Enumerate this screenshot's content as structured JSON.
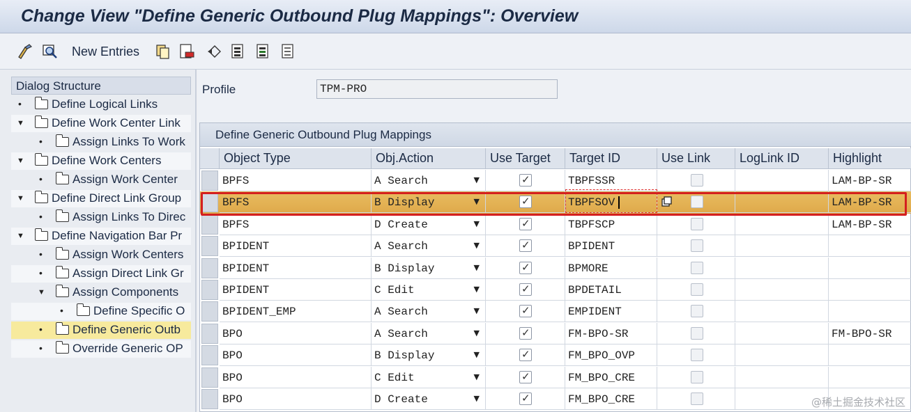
{
  "window": {
    "title": "Change View \"Define Generic Outbound Plug Mappings\": Overview"
  },
  "toolbar": {
    "new_entries_label": "New Entries"
  },
  "dialog_structure": {
    "header": "Dialog Structure",
    "items": [
      {
        "label": "Define Logical Links",
        "level": 0,
        "expander": "bullet"
      },
      {
        "label": "Define Work Center Link",
        "level": 0,
        "expander": "open"
      },
      {
        "label": "Assign Links To Work",
        "level": 1,
        "expander": "bullet"
      },
      {
        "label": "Define Work Centers",
        "level": 0,
        "expander": "open"
      },
      {
        "label": "Assign Work Center",
        "level": 1,
        "expander": "bullet"
      },
      {
        "label": "Define Direct Link Group",
        "level": 0,
        "expander": "open"
      },
      {
        "label": "Assign Links To Direc",
        "level": 1,
        "expander": "bullet"
      },
      {
        "label": "Define Navigation Bar Pr",
        "level": 0,
        "expander": "open"
      },
      {
        "label": "Assign Work Centers",
        "level": 1,
        "expander": "bullet"
      },
      {
        "label": "Assign Direct Link Gr",
        "level": 1,
        "expander": "bullet"
      },
      {
        "label": "Assign Components",
        "level": 1,
        "expander": "open"
      },
      {
        "label": "Define Specific O",
        "level": 2,
        "expander": "bullet"
      },
      {
        "label": "Define Generic Outb",
        "level": 1,
        "expander": "bullet",
        "selected": true
      },
      {
        "label": "Override Generic OP",
        "level": 1,
        "expander": "bullet"
      }
    ]
  },
  "profile": {
    "label": "Profile",
    "value": "TPM-PRO"
  },
  "table": {
    "title": "Define Generic Outbound Plug Mappings",
    "columns": [
      "Object Type",
      "Obj.Action",
      "Use Target",
      "Target ID",
      "Use Link",
      "LogLink ID",
      "Highlight"
    ],
    "rows": [
      {
        "object_type": "BPFS",
        "obj_action": "A Search",
        "use_target": true,
        "target_id": "TBPFSSR",
        "use_link": false,
        "loglink_id": "",
        "highlight": "LAM-BP-SR"
      },
      {
        "object_type": "BPFS",
        "obj_action": "B Display",
        "use_target": true,
        "target_id": "TBPFSOV",
        "use_link": false,
        "loglink_id": "",
        "highlight": "LAM-BP-SR",
        "selected": true
      },
      {
        "object_type": "BPFS",
        "obj_action": "D Create",
        "use_target": true,
        "target_id": "TBPFSCP",
        "use_link": false,
        "loglink_id": "",
        "highlight": "LAM-BP-SR"
      },
      {
        "object_type": "BPIDENT",
        "obj_action": "A Search",
        "use_target": true,
        "target_id": "BPIDENT",
        "use_link": false,
        "loglink_id": "",
        "highlight": ""
      },
      {
        "object_type": "BPIDENT",
        "obj_action": "B Display",
        "use_target": true,
        "target_id": "BPMORE",
        "use_link": false,
        "loglink_id": "",
        "highlight": ""
      },
      {
        "object_type": "BPIDENT",
        "obj_action": "C Edit",
        "use_target": true,
        "target_id": "BPDETAIL",
        "use_link": false,
        "loglink_id": "",
        "highlight": ""
      },
      {
        "object_type": "BPIDENT_EMP",
        "obj_action": "A Search",
        "use_target": true,
        "target_id": "EMPIDENT",
        "use_link": false,
        "loglink_id": "",
        "highlight": ""
      },
      {
        "object_type": "BPO",
        "obj_action": "A Search",
        "use_target": true,
        "target_id": "FM-BPO-SR",
        "use_link": false,
        "loglink_id": "",
        "highlight": "FM-BPO-SR"
      },
      {
        "object_type": "BPO",
        "obj_action": "B Display",
        "use_target": true,
        "target_id": "FM_BPO_OVP",
        "use_link": false,
        "loglink_id": "",
        "highlight": ""
      },
      {
        "object_type": "BPO",
        "obj_action": "C Edit",
        "use_target": true,
        "target_id": "FM_BPO_CRE",
        "use_link": false,
        "loglink_id": "",
        "highlight": ""
      },
      {
        "object_type": "BPO",
        "obj_action": "D Create",
        "use_target": true,
        "target_id": "FM_BPO_CRE",
        "use_link": false,
        "loglink_id": "",
        "highlight": ""
      }
    ]
  },
  "watermark": "@稀土掘金技术社区"
}
